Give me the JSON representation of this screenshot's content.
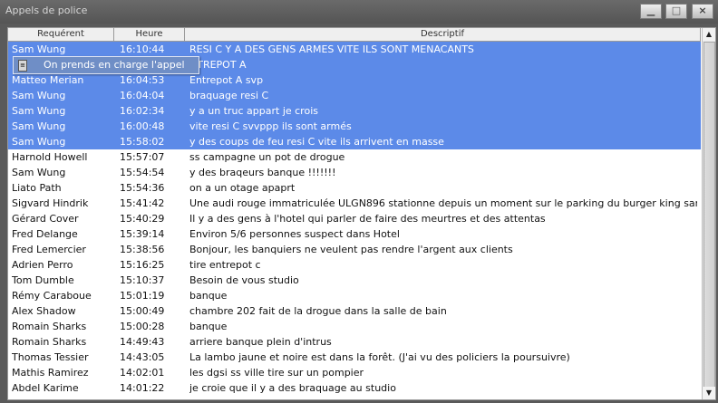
{
  "window": {
    "title": "Appels de police",
    "minimize_glyph": "▁",
    "maximize_glyph": "□",
    "close_glyph": "×"
  },
  "table": {
    "columns": [
      "Requérent",
      "Heure",
      "Descriptif"
    ],
    "rows": [
      {
        "req": "Sam Wung",
        "time": "16:10:44",
        "desc": "RESI C Y A DES GENS ARMES VITE   ILS SONT MENACANTS",
        "selected": true
      },
      {
        "req": "",
        "time": "",
        "desc": "NTREPOT A",
        "selected": true
      },
      {
        "req": "Matteo Merian",
        "time": "16:04:53",
        "desc": "Entrepot A svp",
        "selected": true
      },
      {
        "req": "Sam Wung",
        "time": "16:04:04",
        "desc": "braquage resi C",
        "selected": true
      },
      {
        "req": "Sam Wung",
        "time": "16:02:34",
        "desc": "y a un truc appart je crois",
        "selected": true
      },
      {
        "req": "Sam Wung",
        "time": "16:00:48",
        "desc": "vite resi C svvppp ils sont armés",
        "selected": true
      },
      {
        "req": "Sam Wung",
        "time": "15:58:02",
        "desc": "y des coups de feu resi C vite ils arrivent en masse",
        "selected": true
      },
      {
        "req": "Harnold Howell",
        "time": "15:57:07",
        "desc": "ss campagne un pot de drogue",
        "selected": false
      },
      {
        "req": "Sam Wung",
        "time": "15:54:54",
        "desc": "y des braqeurs banque !!!!!!!",
        "selected": false
      },
      {
        "req": "Liato Path",
        "time": "15:54:36",
        "desc": "on a un otage apaprt",
        "selected": false
      },
      {
        "req": "Sigvard Hindrik",
        "time": "15:41:42",
        "desc": "Une audi rouge immatriculée ULGN896 stationne depuis un moment sur le parking du burger king sans être client",
        "selected": false
      },
      {
        "req": "Gérard Cover",
        "time": "15:40:29",
        "desc": "Il y a des gens à l'hotel qui parler de faire des meurtres et des attentas",
        "selected": false
      },
      {
        "req": "Fred Delange",
        "time": "15:39:14",
        "desc": "Environ 5/6 personnes suspect dans Hotel",
        "selected": false
      },
      {
        "req": "Fred Lemercier",
        "time": "15:38:56",
        "desc": "Bonjour, les banquiers ne veulent pas rendre l'argent aux clients",
        "selected": false
      },
      {
        "req": "Adrien Perro",
        "time": "15:16:25",
        "desc": "tire entrepot c",
        "selected": false
      },
      {
        "req": "Tom Dumble",
        "time": "15:10:37",
        "desc": "Besoin de vous   studio",
        "selected": false
      },
      {
        "req": "Rémy Caraboue",
        "time": "15:01:19",
        "desc": "banque",
        "selected": false
      },
      {
        "req": "Alex Shadow",
        "time": "15:00:49",
        "desc": "chambre 202 fait de la drogue dans la salle de bain",
        "selected": false
      },
      {
        "req": "Romain Sharks",
        "time": "15:00:28",
        "desc": "banque",
        "selected": false
      },
      {
        "req": "Romain Sharks",
        "time": "14:49:43",
        "desc": "arriere banque plein d'intrus",
        "selected": false
      },
      {
        "req": "Thomas Tessier",
        "time": "14:43:05",
        "desc": "La lambo jaune et noire est dans la forêt. (J'ai vu des policiers la poursuivre)",
        "selected": false
      },
      {
        "req": "Mathis Ramirez",
        "time": "14:02:01",
        "desc": "les dgsi ss ville tire sur un pompier",
        "selected": false
      },
      {
        "req": "Abdel Karime",
        "time": "14:01:22",
        "desc": "je croie que il y a des braquage au studio",
        "selected": false
      }
    ]
  },
  "context_menu": {
    "label": "On prends en charge l'appel",
    "icon": "document-icon"
  },
  "scrollbar": {
    "up_glyph": "▲",
    "down_glyph": "▼"
  },
  "colors": {
    "selection": "#5c8ae8",
    "menu": "#6f8ec6"
  }
}
